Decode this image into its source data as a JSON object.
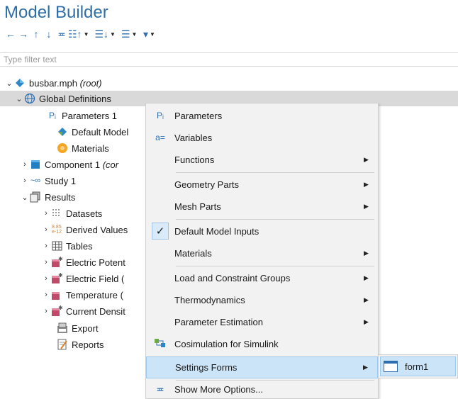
{
  "header": {
    "title": "Model Builder"
  },
  "toolbar": {
    "buttons": [
      {
        "icon": "arrow-left-icon",
        "glyph": "←"
      },
      {
        "icon": "arrow-right-icon",
        "glyph": "→"
      },
      {
        "icon": "arrow-up-icon",
        "glyph": "↑"
      },
      {
        "icon": "arrow-down-icon",
        "glyph": "↓"
      },
      {
        "icon": "show-more-options-icon",
        "glyph": "≖"
      },
      {
        "icon": "collapse-expand-icon",
        "glyph": "☷↑"
      },
      {
        "icon": "list-expand-icon",
        "glyph": "☰↓"
      },
      {
        "icon": "list-view-icon",
        "glyph": "☰"
      },
      {
        "icon": "pin-dropdown-icon",
        "glyph": "▼"
      }
    ]
  },
  "filter": {
    "placeholder": "Type filter text"
  },
  "tree": {
    "root": {
      "name": "busbar.mph",
      "suffix": "(root)"
    },
    "global_definitions": "Global Definitions",
    "parameters_1": "Parameters 1",
    "default_model": "Default Model",
    "materials": "Materials",
    "component_1": "Component 1",
    "component_1_suffix": "(cor",
    "study_1": "Study 1",
    "results": "Results",
    "datasets": "Datasets",
    "derived_values": "Derived Values",
    "tables": "Tables",
    "electric_potential": "Electric Potent",
    "electric_field": "Electric Field (",
    "temperature": "Temperature (",
    "current_density": "Current Densit",
    "export": "Export",
    "reports": "Reports"
  },
  "context_menu": {
    "items": [
      {
        "label": "Parameters",
        "icon": "Pᵢ"
      },
      {
        "label": "Variables",
        "icon": "a="
      },
      {
        "label": "Functions"
      },
      {
        "label": "Geometry Parts"
      },
      {
        "label": "Mesh Parts"
      },
      {
        "label": "Default Model Inputs",
        "checked": true
      },
      {
        "label": "Materials"
      },
      {
        "label": "Load and Constraint Groups"
      },
      {
        "label": "Thermodynamics"
      },
      {
        "label": "Parameter Estimation"
      },
      {
        "label": "Cosimulation for Simulink"
      },
      {
        "label": "Settings Forms",
        "highlighted": true
      },
      {
        "label": "Show More Options..."
      }
    ],
    "check_glyph": "✓",
    "submenu_arrow": "▶"
  },
  "submenu": {
    "items": [
      {
        "label": "form1"
      }
    ]
  },
  "colors": {
    "title": "#2e6ea6",
    "highlight": "#cce4f7",
    "selected_row": "#d9d9d9"
  }
}
